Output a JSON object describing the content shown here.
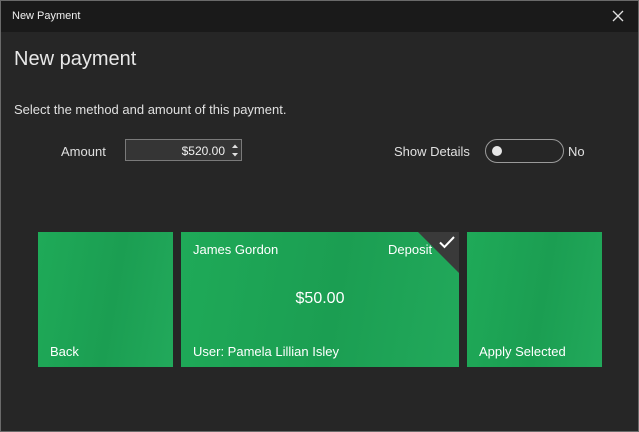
{
  "window": {
    "title": "New Payment",
    "close_icon": "close-icon"
  },
  "page": {
    "heading": "New payment",
    "subtitle": "Select the method and amount of this payment."
  },
  "amount": {
    "label": "Amount",
    "value": "$520.00"
  },
  "details": {
    "label": "Show Details",
    "toggle_on": false,
    "toggle_text": "No"
  },
  "tiles": {
    "back": {
      "label": "Back"
    },
    "payment": {
      "name": "James Gordon",
      "type": "Deposit",
      "amount": "$50.00",
      "user": "User: Pamela Lillian Isley",
      "selected": true
    },
    "apply": {
      "label": "Apply Selected"
    }
  },
  "colors": {
    "tile_green": "#1faa58",
    "background": "#262626",
    "titlebar": "#1a1a1a",
    "text": "#e0e0e0"
  }
}
